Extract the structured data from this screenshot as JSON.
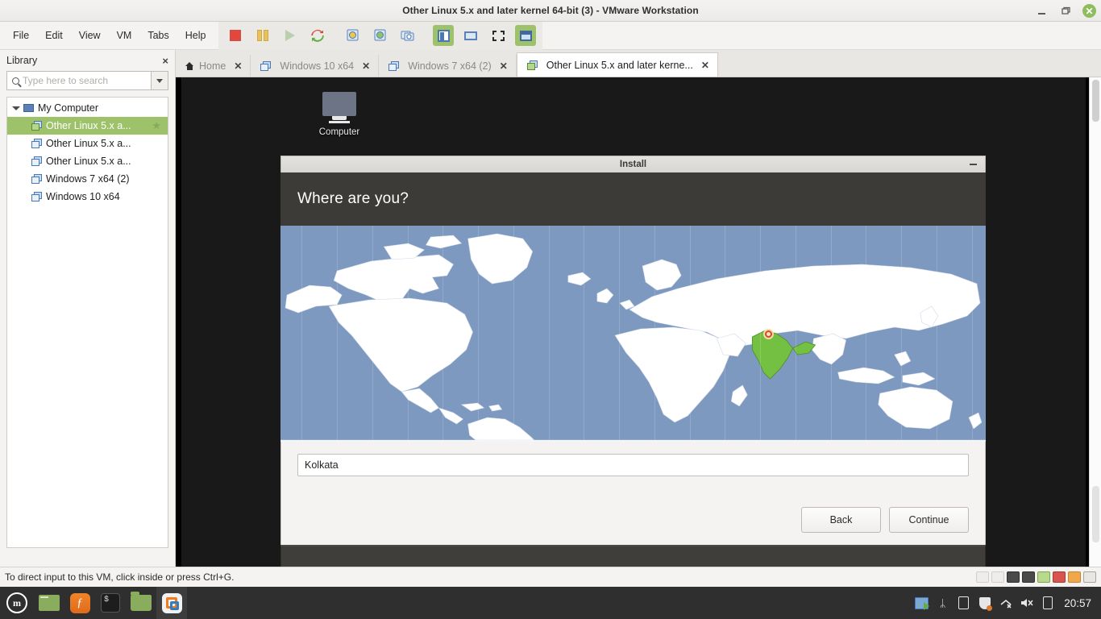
{
  "window": {
    "title": "Other Linux 5.x and later kernel 64-bit (3) - VMware Workstation",
    "minimize_label": "Minimize",
    "maximize_label": "Restore",
    "close_label": "Close"
  },
  "menubar": {
    "items": [
      "File",
      "Edit",
      "View",
      "VM",
      "Tabs",
      "Help"
    ]
  },
  "toolbar": {
    "buttons": [
      {
        "name": "power-off-icon",
        "title": "Power Off"
      },
      {
        "name": "suspend-icon",
        "title": "Suspend"
      },
      {
        "name": "power-on-icon",
        "title": "Power On"
      },
      {
        "name": "restart-icon",
        "title": "Restart Guest"
      },
      {
        "name": "snapshot-take-icon",
        "title": "Take Snapshot"
      },
      {
        "name": "snapshot-revert-icon",
        "title": "Revert Snapshot"
      },
      {
        "name": "snapshot-manager-icon",
        "title": "Snapshot Manager"
      },
      {
        "name": "show-library-icon",
        "title": "Show or hide the Library"
      },
      {
        "name": "console-view-icon",
        "title": "Console View"
      },
      {
        "name": "fullscreen-icon",
        "title": "Enter full screen mode"
      },
      {
        "name": "unity-mode-icon",
        "title": "Unity mode"
      }
    ]
  },
  "sidebar": {
    "title": "Library",
    "close_label": "×",
    "search": {
      "placeholder": "Type here to search",
      "value": ""
    },
    "tree": {
      "root": "My Computer",
      "items": [
        {
          "label": "Other Linux 5.x a...",
          "state": "running",
          "selected": true,
          "favorite": true
        },
        {
          "label": "Other Linux 5.x a...",
          "state": "off",
          "selected": false,
          "favorite": false
        },
        {
          "label": "Other Linux 5.x a...",
          "state": "off",
          "selected": false,
          "favorite": false
        },
        {
          "label": "Windows 7 x64 (2)",
          "state": "off",
          "selected": false,
          "favorite": false
        },
        {
          "label": "Windows 10 x64",
          "state": "off",
          "selected": false,
          "favorite": false
        }
      ]
    }
  },
  "tabs": [
    {
      "label": "Home",
      "icon": "home-icon",
      "active": false,
      "close": "✕"
    },
    {
      "label": "Windows 10 x64",
      "icon": "vm-icon",
      "active": false,
      "close": "✕"
    },
    {
      "label": "Windows 7 x64 (2)",
      "icon": "vm-icon",
      "active": false,
      "close": "✕"
    },
    {
      "label": "Other Linux 5.x and later kerne...",
      "icon": "vm-icon",
      "active": true,
      "close": "✕"
    }
  ],
  "guest": {
    "desktop_icon": {
      "label": "Computer"
    },
    "dialog": {
      "titlebar": "Install",
      "minimize_label": "–",
      "heading": "Where are you?",
      "city_input": {
        "value": "Kolkata",
        "placeholder": ""
      },
      "back_label": "Back",
      "continue_label": "Continue",
      "map": {
        "ocean_color": "#7e99c0",
        "land_color": "#ffffff",
        "highlight_color": "#74c043",
        "highlight_country": "India",
        "marker_color": "#d6453a",
        "timezone_lines": true
      }
    }
  },
  "statusbar": {
    "message": "To direct input to this VM, click inside or press Ctrl+G.",
    "devices": [
      {
        "name": "floppy-device-icon",
        "state": "disabled"
      },
      {
        "name": "cd-dvd-device-icon",
        "state": "disabled"
      },
      {
        "name": "network-device-icon",
        "state": "connected"
      },
      {
        "name": "usb-device-icon",
        "state": "connected"
      },
      {
        "name": "sound-device-icon",
        "state": "connected"
      },
      {
        "name": "printer-device-icon",
        "state": "disconnected"
      },
      {
        "name": "display-device-icon",
        "state": "disconnected"
      },
      {
        "name": "message-log-icon",
        "state": "normal"
      }
    ]
  },
  "taskbar": {
    "menu_button": "menu-icon",
    "mint_glyph": "m",
    "launchers": [
      {
        "name": "show-desktop-icon"
      },
      {
        "name": "firefox-icon",
        "glyph": "ƒ"
      },
      {
        "name": "terminal-icon",
        "glyph": "$"
      },
      {
        "name": "files-icon"
      },
      {
        "name": "vmware-workstation-icon",
        "active": true
      }
    ],
    "tray": [
      {
        "name": "vmware-tray-icon"
      },
      {
        "name": "bluetooth-icon",
        "glyph": "ᛦ"
      },
      {
        "name": "clipboard-icon"
      },
      {
        "name": "update-manager-icon"
      },
      {
        "name": "network-icon"
      },
      {
        "name": "volume-muted-icon"
      },
      {
        "name": "battery-icon"
      }
    ],
    "clock": "20:57"
  }
}
